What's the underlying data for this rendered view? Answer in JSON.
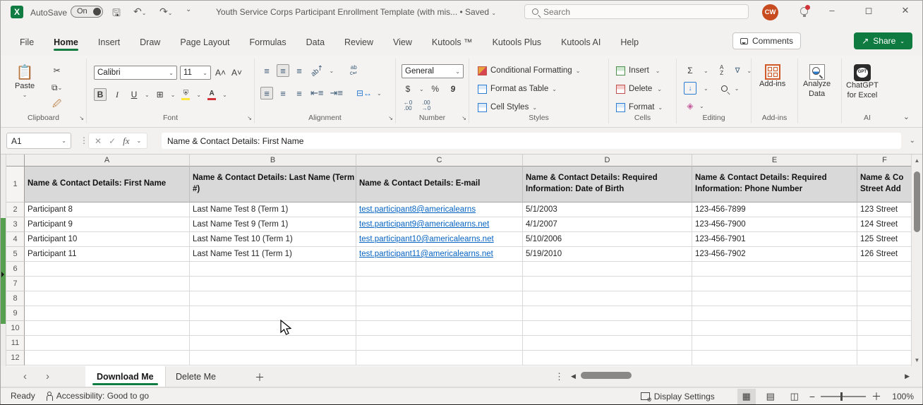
{
  "colors": {
    "accent_green": "#107c41",
    "share_green": "#0f7b41",
    "avatar_orange": "#c74b1e",
    "header_fill": "#d9d9d9",
    "link_blue": "#0563c1",
    "strip_green": "#56a050"
  },
  "titlebar": {
    "autosave_label": "AutoSave",
    "autosave_state": "On",
    "doc_title": "Youth Service Corps Participant Enrollment Template (with mis...",
    "save_status": "Saved",
    "search_placeholder": "Search",
    "avatar_initials": "CW"
  },
  "tabs": {
    "items": [
      "File",
      "Home",
      "Insert",
      "Draw",
      "Page Layout",
      "Formulas",
      "Data",
      "Review",
      "View",
      "Kutools ™",
      "Kutools Plus",
      "Kutools AI",
      "Help"
    ],
    "active": "Home",
    "comments_label": "Comments",
    "share_label": "Share"
  },
  "ribbon": {
    "paste_label": "Paste",
    "font_name": "Calibri",
    "font_size": "11",
    "bold": "B",
    "italic": "I",
    "underline": "U",
    "number_format": "General",
    "currency": "$",
    "percent": "%",
    "comma": "9",
    "styles_buttons": {
      "conditional": "Conditional Formatting",
      "table": "Format as Table",
      "cellstyles": "Cell Styles"
    },
    "cells_buttons": {
      "insert": "Insert",
      "delete": "Delete",
      "format": "Format"
    },
    "addins_label": "Add-ins",
    "analyze_label_1": "Analyze",
    "analyze_label_2": "Data",
    "chatgpt_label_1": "ChatGPT",
    "chatgpt_label_2": "for Excel",
    "group_labels": {
      "clipboard": "Clipboard",
      "font": "Font",
      "alignment": "Alignment",
      "number": "Number",
      "styles": "Styles",
      "cells": "Cells",
      "editing": "Editing",
      "addins": "Add-ins",
      "ai": "AI"
    }
  },
  "formula_bar": {
    "name_box": "A1",
    "fx": "fx",
    "content": "Name & Contact Details: First Name"
  },
  "grid": {
    "col_letters": [
      "A",
      "B",
      "C",
      "D",
      "E",
      "F"
    ],
    "header_cells": [
      "Name & Contact Details: First Name",
      "Name & Contact Details: Last Name (Term #)",
      "Name & Contact Details: E-mail",
      "Name & Contact Details: Required Information: Date of Birth",
      "Name & Contact Details: Required Information: Phone Number",
      "Name & Co Street Add"
    ],
    "rows": [
      {
        "n": "2",
        "cells": [
          "Participant 8",
          "Last Name Test 8 (Term 1)",
          "test.participant8@americalearns",
          "5/1/2003",
          "123-456-7899",
          "123 Street"
        ]
      },
      {
        "n": "3",
        "cells": [
          "Participant 9",
          "Last Name Test 9 (Term 1)",
          "test.participant9@americalearns.net",
          "4/1/2007",
          "123-456-7900",
          "124 Street"
        ]
      },
      {
        "n": "4",
        "cells": [
          "Participant 10",
          "Last Name Test 10 (Term 1)",
          "test.participant10@americalearns.net",
          "5/10/2006",
          "123-456-7901",
          "125 Street"
        ]
      },
      {
        "n": "5",
        "cells": [
          "Participant 11",
          "Last Name Test 11 (Term 1)",
          "test.participant11@americalearns.net",
          "5/19/2010",
          "123-456-7902",
          "126 Street"
        ]
      }
    ],
    "empty_row_numbers": [
      "6",
      "7",
      "8",
      "9",
      "10",
      "11",
      "12"
    ],
    "link_column_index": 2
  },
  "sheets": {
    "tabs": [
      "Download Me",
      "Delete Me"
    ],
    "active": "Download Me"
  },
  "statusbar": {
    "ready": "Ready",
    "accessibility": "Accessibility: Good to go",
    "display_settings": "Display Settings",
    "zoom_level": "100%"
  }
}
